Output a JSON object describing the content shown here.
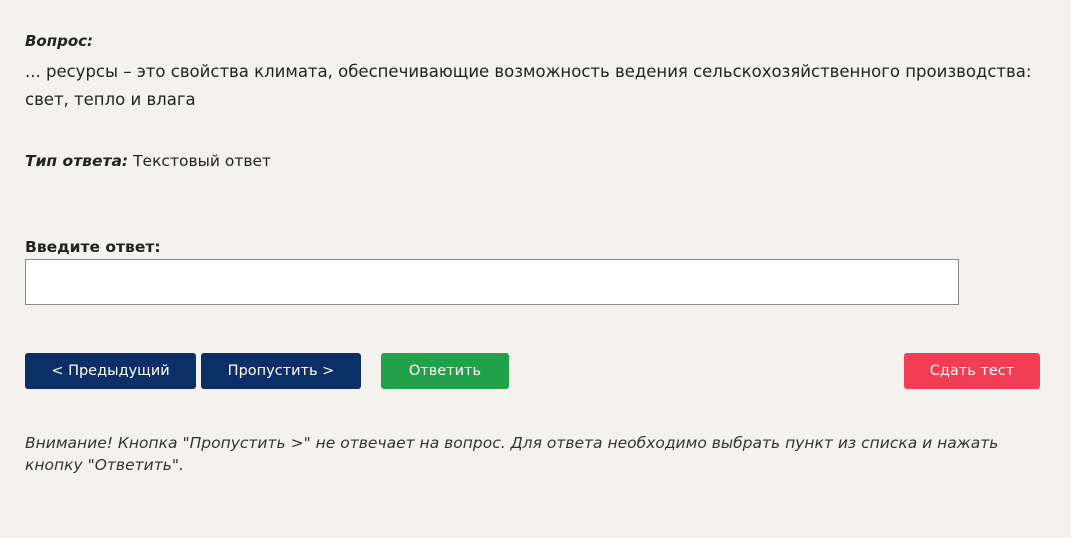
{
  "question": {
    "label": "Вопрос:",
    "text": "... ресурсы – это свойства климата, обеспечивающие возможность ведения сельскохозяйственного производства: свет, тепло и влага"
  },
  "answer_type": {
    "label": "Тип ответа:",
    "value": " Текстовый ответ"
  },
  "answer_input": {
    "label": "Введите ответ:",
    "value": ""
  },
  "buttons": {
    "prev": "< Предыдущий",
    "skip": "Пропустить >",
    "answer": "Ответить",
    "submit": "Сдать тест"
  },
  "colors": {
    "nav_button": "#0b2f66",
    "answer_button": "#23a04a",
    "submit_button": "#f23d55",
    "background": "#f3f2ef"
  },
  "notice": "Внимание! Кнопка \"Пропустить >\" не отвечает на вопрос. Для ответа необходимо выбрать пункт из списка и нажать кнопку \"Ответить\"."
}
